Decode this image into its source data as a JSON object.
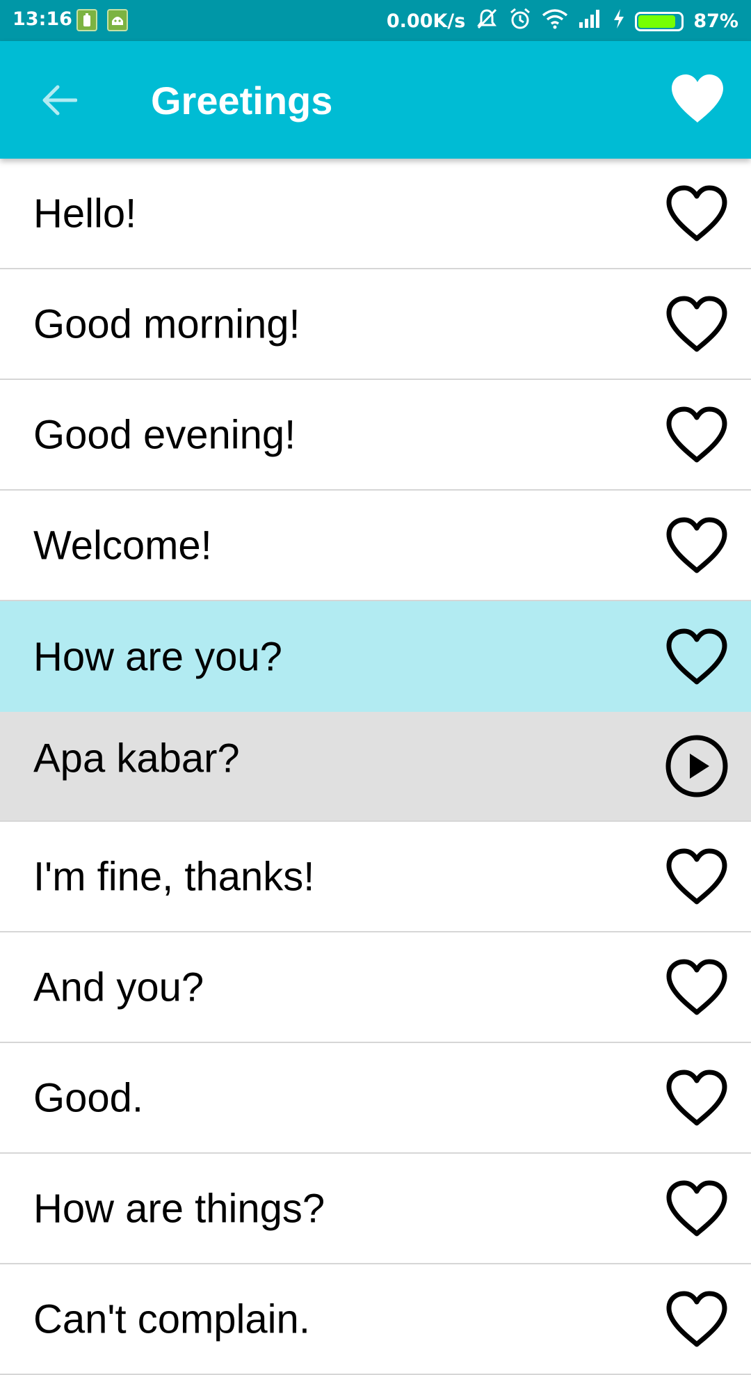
{
  "status_bar": {
    "time": "13:16",
    "net_speed": "0.00K/s",
    "battery_percent": "87%",
    "battery_level": 0.87,
    "icons": [
      "battery-saver-icon",
      "android-icon",
      "mute-icon",
      "alarm-icon",
      "wifi-icon",
      "signal-icon",
      "charging-icon"
    ]
  },
  "app_bar": {
    "title": "Greetings",
    "back_icon": "arrow-back-icon",
    "favorite_icon": "heart-filled-icon"
  },
  "colors": {
    "status_bar": "#0097A7",
    "app_bar": "#00BCD4",
    "selected_row": "#B2EBF2",
    "translation_row": "#E0E0E0"
  },
  "phrases": [
    {
      "text": "Hello!",
      "icon": "heart-outline-icon"
    },
    {
      "text": "Good morning!",
      "icon": "heart-outline-icon"
    },
    {
      "text": "Good evening!",
      "icon": "heart-outline-icon"
    },
    {
      "text": "Welcome!",
      "icon": "heart-outline-icon"
    },
    {
      "text": "How are you?",
      "icon": "heart-outline-icon",
      "selected": true
    },
    {
      "text": "Apa kabar?",
      "icon": "play-icon",
      "translation": true
    },
    {
      "text": "I'm fine, thanks!",
      "icon": "heart-outline-icon"
    },
    {
      "text": "And you?",
      "icon": "heart-outline-icon"
    },
    {
      "text": "Good.",
      "icon": "heart-outline-icon"
    },
    {
      "text": "How are things?",
      "icon": "heart-outline-icon"
    },
    {
      "text": "Can't complain.",
      "icon": "heart-outline-icon"
    }
  ]
}
